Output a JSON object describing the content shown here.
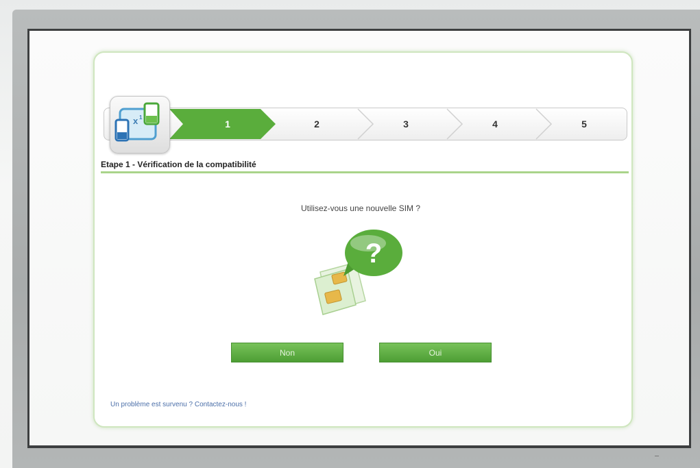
{
  "wizard": {
    "steps": [
      "1",
      "2",
      "3",
      "4",
      "5"
    ],
    "active_step": 1,
    "section_title": "Etape 1 - Vérification de la compatibilité"
  },
  "question": {
    "text": "Utilisez-vous une nouvelle SIM ?",
    "badge": "?"
  },
  "buttons": {
    "no_label": "Non",
    "yes_label": "Oui"
  },
  "help_link": "Un problème est survenu ? Contactez-nous !",
  "icons": [
    "transfer-phones-icon",
    "question-bubble-icon",
    "sim-card-icon"
  ],
  "colors": {
    "accent_green": "#5aad3c",
    "rule_green": "#a9d48a",
    "link_blue": "#4a6ea8"
  }
}
